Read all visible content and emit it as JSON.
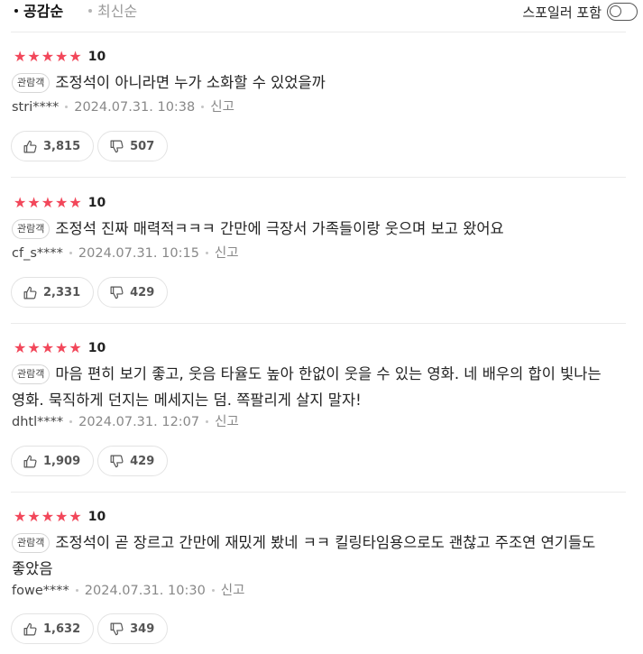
{
  "sort": {
    "active_label": "공감순",
    "inactive_label": "최신순"
  },
  "spoiler": {
    "label": "스포일러 포함",
    "enabled": false
  },
  "star_icon": "★",
  "colors": {
    "star": "#f2475a",
    "divider": "#ebebeb"
  },
  "reviews": [
    {
      "score": "10",
      "badge": "관람객",
      "text": "조정석이 아니라면 누가 소화할 수 있었을까",
      "user": "stri****",
      "date": "2024.07.31. 10:38",
      "report": "신고",
      "likes": "3,815",
      "dislikes": "507"
    },
    {
      "score": "10",
      "badge": "관람객",
      "text": "조정석 진짜 매력적ㅋㅋㅋ 간만에 극장서 가족들이랑 웃으며 보고 왔어요",
      "user": "cf_s****",
      "date": "2024.07.31. 10:15",
      "report": "신고",
      "likes": "2,331",
      "dislikes": "429"
    },
    {
      "score": "10",
      "badge": "관람객",
      "text": "마음 편히 보기 좋고, 웃음 타율도 높아 한없이 웃을 수 있는 영화. 네 배우의 합이 빛나는 영화. 묵직하게 던지는 메세지는 덤. 쪽팔리게 살지 말자!",
      "user": "dhtl****",
      "date": "2024.07.31. 12:07",
      "report": "신고",
      "likes": "1,909",
      "dislikes": "429"
    },
    {
      "score": "10",
      "badge": "관람객",
      "text": "조정석이 곧 장르고 간만에 재밌게 봤네 ㅋㅋ 킬링타임용으로도 괜찮고 주조연 연기들도 좋았음",
      "user": "fowe****",
      "date": "2024.07.31. 10:30",
      "report": "신고",
      "likes": "1,632",
      "dislikes": "349"
    }
  ]
}
